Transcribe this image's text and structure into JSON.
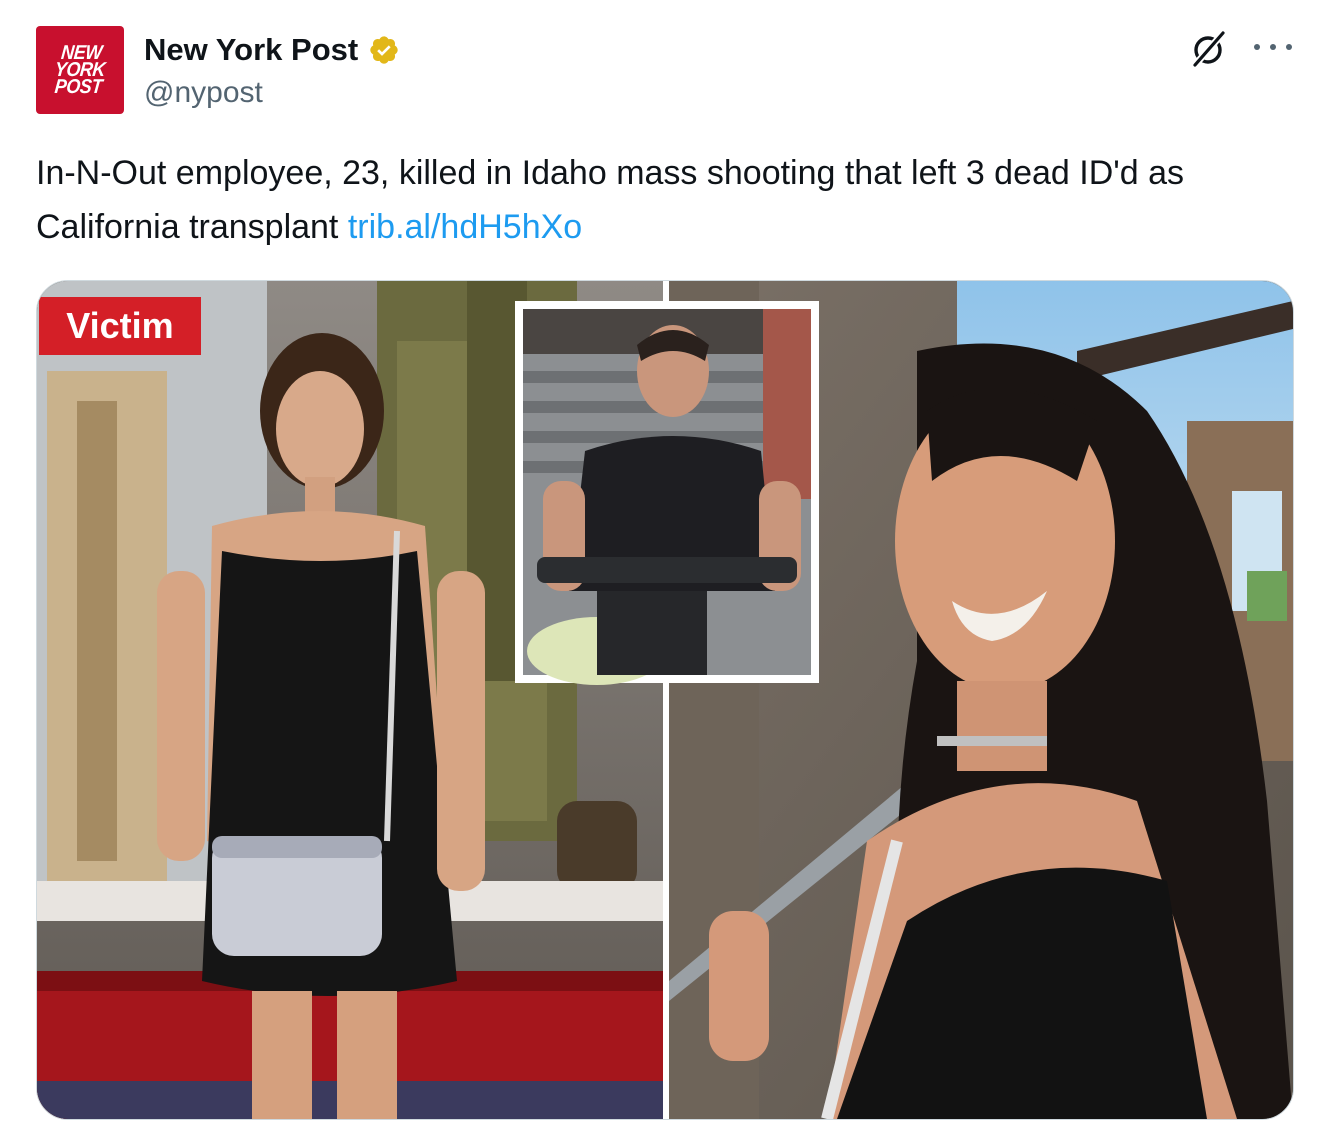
{
  "tweet": {
    "avatar_text": "NEW\nYORK\nPOST",
    "display_name": "New York Post",
    "handle": "@nypost",
    "text": "In-N-Out employee, 23, killed in Idaho mass shooting that left 3 dead ID'd as California transplant",
    "link_text": "trib.al/hdH5hXo"
  },
  "media": {
    "badge_label": "Victim"
  },
  "colors": {
    "brand_red": "#c8102e",
    "verified_gold": "#e2b719",
    "link_blue": "#1d9bf0",
    "handle_gray": "#536471",
    "badge_red": "#d41f27"
  },
  "icons": {
    "verified": "verified-badge-icon",
    "grok": "grok-icon",
    "more": "more-options-icon"
  }
}
